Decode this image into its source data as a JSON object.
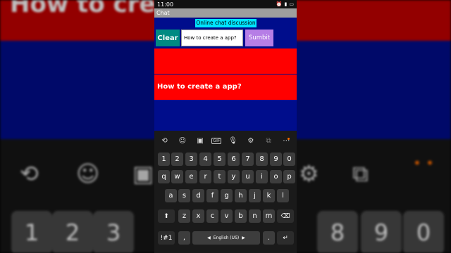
{
  "background": {
    "heading_text": "How to create",
    "bottom_keys": [
      "1",
      "2",
      "3",
      "8",
      "9",
      "0"
    ]
  },
  "status_bar": {
    "time": "11:00"
  },
  "app": {
    "title": "Chat",
    "heading": "Online chat discussion",
    "clear_label": "Clear",
    "input_value": "How to create a app?",
    "submit_label": "Sumbit",
    "messages": [
      "",
      "How to create a app?"
    ]
  },
  "keyboard": {
    "toolbar": [
      "translate-icon",
      "emoji-icon",
      "sticker-icon",
      "gif-icon",
      "mic-icon",
      "settings-icon",
      "clipboard-icon",
      "more-icon"
    ],
    "gif_label": "GIF",
    "number_row": [
      "1",
      "2",
      "3",
      "4",
      "5",
      "6",
      "7",
      "8",
      "9",
      "0"
    ],
    "row1": [
      "q",
      "w",
      "e",
      "r",
      "t",
      "y",
      "u",
      "i",
      "o",
      "p"
    ],
    "row2": [
      "a",
      "s",
      "d",
      "f",
      "g",
      "h",
      "j",
      "k",
      "l"
    ],
    "row3": [
      "z",
      "x",
      "c",
      "v",
      "b",
      "n",
      "m"
    ],
    "sym_label": "!#1",
    "comma": ",",
    "space_label": "English (US)",
    "period": ".",
    "accent": {
      "notification_dot": "#ff6d00",
      "clear_button": "#008a82",
      "submit_button": "#b67ee6",
      "heading_bg": "#00e5ff",
      "message_bg": "#ff0000",
      "app_bg": "#000d8c"
    }
  }
}
